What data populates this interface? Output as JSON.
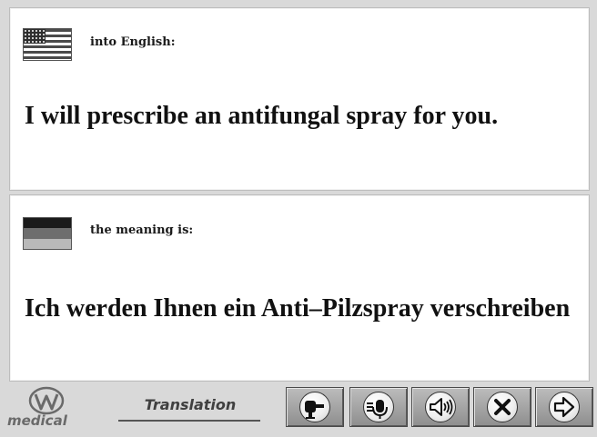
{
  "source": {
    "language_label": "into English:",
    "flag_icon": "us-flag-icon",
    "phrase": "I will prescribe an antifungal spray for you."
  },
  "target": {
    "language_label": "the meaning is:",
    "flag_icon": "germany-flag-icon",
    "phrase": "Ich werden Ihnen ein Anti–Pilzspray verschreiben"
  },
  "toolbar": {
    "logo_text": "medical",
    "title": "Translation",
    "buttons": [
      {
        "icon": "microphone-icon",
        "action": "record"
      },
      {
        "icon": "microphone-playback-icon",
        "action": "record-alt"
      },
      {
        "icon": "speaker-icon",
        "action": "speak"
      },
      {
        "icon": "close-icon",
        "action": "close"
      },
      {
        "icon": "arrow-right-icon",
        "action": "next"
      }
    ]
  }
}
